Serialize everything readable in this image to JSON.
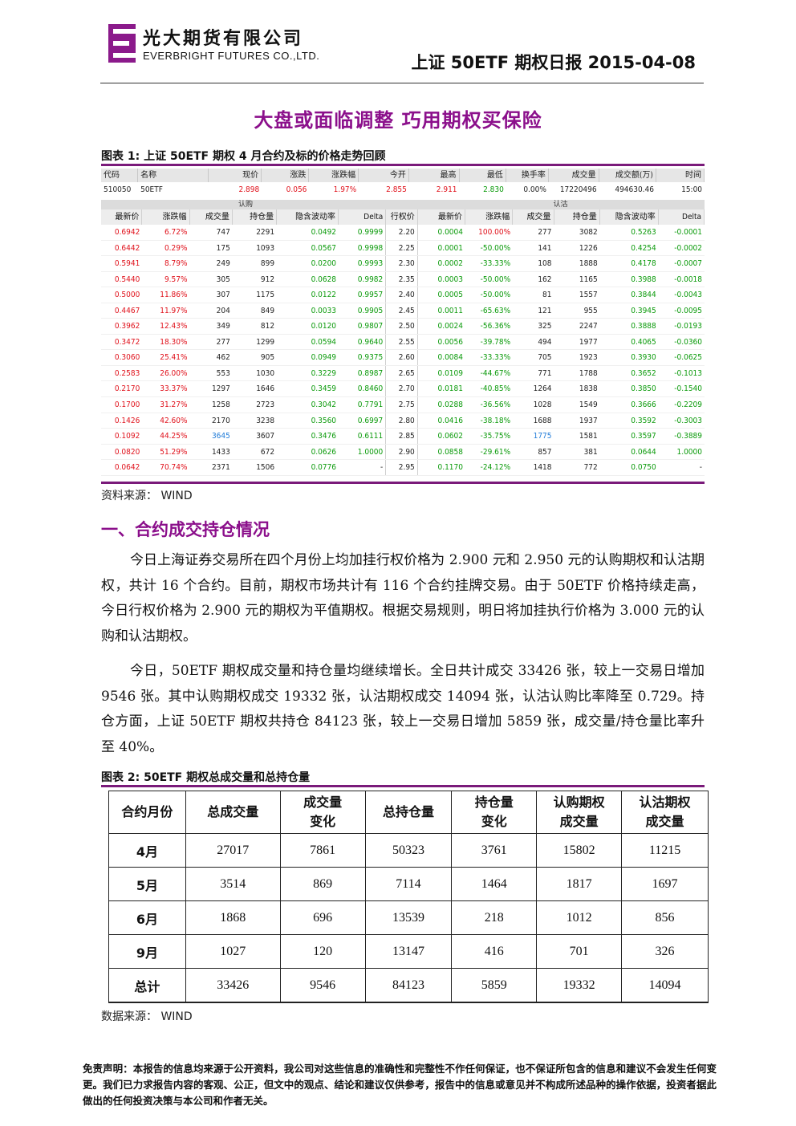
{
  "header": {
    "company_cn": "光大期货有限公司",
    "company_en": "EVERBRIGHT FUTURES CO.,LTD.",
    "report_title": "上证 50ETF 期权日报 2015-04-08",
    "logo_color": "#8b1a8b"
  },
  "main_title": "大盘或面临调整  巧用期权买保险",
  "figure1": {
    "title": "图表 1:  上证 50ETF 期权 4 月合约及标的价格走势回顾",
    "underlying_headers": [
      "代码",
      "名称",
      "现价",
      "涨跌",
      "涨跌幅",
      "今开",
      "最高",
      "最低",
      "换手率",
      "成交量",
      "成交额(万)",
      "时间"
    ],
    "underlying_values": [
      "510050",
      "50ETF",
      "2.898",
      "0.056",
      "1.97%",
      "2.855",
      "2.911",
      "2.830",
      "0.00%",
      "17220496",
      "494630.46",
      "15:00"
    ],
    "band_call": "认购",
    "band_put": "认沽",
    "call_headers": [
      "最新价",
      "涨跌幅",
      "成交量",
      "持仓量",
      "隐含波动率",
      "Delta"
    ],
    "strike_header": "行权价",
    "put_headers": [
      "最新价",
      "涨跌幅",
      "成交量",
      "持仓量",
      "隐含波动率",
      "Delta"
    ],
    "rows": [
      {
        "c": [
          "0.6942",
          "6.72%",
          "747",
          "2291",
          "0.0492",
          "0.9999"
        ],
        "k": "2.20",
        "p": [
          "0.0004",
          "100.00%",
          "277",
          "3082",
          "0.5263",
          "-0.0001"
        ]
      },
      {
        "c": [
          "0.6442",
          "0.29%",
          "175",
          "1093",
          "0.0567",
          "0.9998"
        ],
        "k": "2.25",
        "p": [
          "0.0001",
          "-50.00%",
          "141",
          "1226",
          "0.4254",
          "-0.0002"
        ]
      },
      {
        "c": [
          "0.5941",
          "8.79%",
          "249",
          "899",
          "0.0200",
          "0.9993"
        ],
        "k": "2.30",
        "p": [
          "0.0002",
          "-33.33%",
          "108",
          "1888",
          "0.4178",
          "-0.0007"
        ]
      },
      {
        "c": [
          "0.5440",
          "9.57%",
          "305",
          "912",
          "0.0628",
          "0.9982"
        ],
        "k": "2.35",
        "p": [
          "0.0003",
          "-50.00%",
          "162",
          "1165",
          "0.3988",
          "-0.0018"
        ]
      },
      {
        "c": [
          "0.5000",
          "11.86%",
          "307",
          "1175",
          "0.0122",
          "0.9957"
        ],
        "k": "2.40",
        "p": [
          "0.0005",
          "-50.00%",
          "81",
          "1557",
          "0.3844",
          "-0.0043"
        ]
      },
      {
        "c": [
          "0.4467",
          "11.97%",
          "204",
          "849",
          "0.0033",
          "0.9905"
        ],
        "k": "2.45",
        "p": [
          "0.0011",
          "-65.63%",
          "121",
          "955",
          "0.3945",
          "-0.0095"
        ]
      },
      {
        "c": [
          "0.3962",
          "12.43%",
          "349",
          "812",
          "0.0120",
          "0.9807"
        ],
        "k": "2.50",
        "p": [
          "0.0024",
          "-56.36%",
          "325",
          "2247",
          "0.3888",
          "-0.0193"
        ]
      },
      {
        "c": [
          "0.3472",
          "18.30%",
          "277",
          "1299",
          "0.0594",
          "0.9640"
        ],
        "k": "2.55",
        "p": [
          "0.0056",
          "-39.78%",
          "494",
          "1977",
          "0.4065",
          "-0.0360"
        ]
      },
      {
        "c": [
          "0.3060",
          "25.41%",
          "462",
          "905",
          "0.0949",
          "0.9375"
        ],
        "k": "2.60",
        "p": [
          "0.0084",
          "-33.33%",
          "705",
          "1923",
          "0.3930",
          "-0.0625"
        ]
      },
      {
        "c": [
          "0.2583",
          "26.00%",
          "553",
          "1030",
          "0.3229",
          "0.8987"
        ],
        "k": "2.65",
        "p": [
          "0.0109",
          "-44.67%",
          "771",
          "1788",
          "0.3652",
          "-0.1013"
        ]
      },
      {
        "c": [
          "0.2170",
          "33.37%",
          "1297",
          "1646",
          "0.3459",
          "0.8460"
        ],
        "k": "2.70",
        "p": [
          "0.0181",
          "-40.85%",
          "1264",
          "1838",
          "0.3850",
          "-0.1540"
        ]
      },
      {
        "c": [
          "0.1700",
          "31.27%",
          "1258",
          "2723",
          "0.3042",
          "0.7791"
        ],
        "k": "2.75",
        "p": [
          "0.0288",
          "-36.56%",
          "1028",
          "1549",
          "0.3666",
          "-0.2209"
        ]
      },
      {
        "c": [
          "0.1426",
          "42.60%",
          "2170",
          "3238",
          "0.3560",
          "0.6997"
        ],
        "k": "2.80",
        "p": [
          "0.0416",
          "-38.18%",
          "1688",
          "1937",
          "0.3592",
          "-0.3003"
        ]
      },
      {
        "c": [
          "0.1092",
          "44.25%",
          "3645",
          "3607",
          "0.3476",
          "0.6111"
        ],
        "k": "2.85",
        "p": [
          "0.0602",
          "-35.75%",
          "1775",
          "1581",
          "0.3597",
          "-0.3889"
        ]
      },
      {
        "c": [
          "0.0820",
          "51.29%",
          "1433",
          "672",
          "0.0626",
          "1.0000"
        ],
        "k": "2.90",
        "p": [
          "0.0858",
          "-29.61%",
          "857",
          "381",
          "0.0644",
          "1.0000"
        ]
      },
      {
        "c": [
          "0.0642",
          "70.74%",
          "2371",
          "1506",
          "0.0776",
          "-"
        ],
        "k": "2.95",
        "p": [
          "0.1170",
          "-24.12%",
          "1418",
          "772",
          "0.0750",
          "-"
        ]
      }
    ],
    "source": "资料来源：  WIND"
  },
  "section1_title": "一、合约成交持仓情况",
  "paragraphs": [
    "今日上海证券交易所在四个月份上均加挂行权价格为 2.900 元和 2.950 元的认购期权和认沽期权，共计 16 个合约。目前，期权市场共计有 116 个合约挂牌交易。由于 50ETF 价格持续走高，今日行权价格为 2.900 元的期权为平值期权。根据交易规则，明日将加挂执行价格为 3.000 元的认购和认沽期权。",
    "今日，50ETF 期权成交量和持仓量均继续增长。全日共计成交 33426 张，较上一交易日增加 9546 张。其中认购期权成交 19332 张，认沽期权成交 14094 张，认沽认购比率降至 0.729。持仓方面，上证 50ETF 期权共持仓 84123 张，较上一交易日增加 5859 张，成交量/持仓量比率升至 40%。"
  ],
  "figure2": {
    "title": "图表 2:  50ETF 期权总成交量和总持仓量",
    "headers": [
      [
        "合约月份"
      ],
      [
        "总成交量"
      ],
      [
        "成交量",
        "变化"
      ],
      [
        "总持仓量"
      ],
      [
        "持仓量",
        "变化"
      ],
      [
        "认购期权",
        "成交量"
      ],
      [
        "认沽期权",
        "成交量"
      ]
    ],
    "rows": [
      [
        "4月",
        "27017",
        "7861",
        "50323",
        "3761",
        "15802",
        "11215"
      ],
      [
        "5月",
        "3514",
        "869",
        "7114",
        "1464",
        "1817",
        "1697"
      ],
      [
        "6月",
        "1868",
        "696",
        "13539",
        "218",
        "1012",
        "856"
      ],
      [
        "9月",
        "1027",
        "120",
        "13147",
        "416",
        "701",
        "326"
      ],
      [
        "总计",
        "33426",
        "9546",
        "84123",
        "5859",
        "19332",
        "14094"
      ]
    ],
    "source": "数据来源：  WIND"
  },
  "disclaimer": "免责声明：本报告的信息均来源于公开资料，我公司对这些信息的准确性和完整性不作任何保证，也不保证所包含的信息和建议不会发生任何变更。我们已力求报告内容的客观、公正，但文中的观点、结论和建议仅供参考，报告中的信息或意见并不构成所述品种的操作依据，投资者据此做出的任何投资决策与本公司和作者无关。"
}
